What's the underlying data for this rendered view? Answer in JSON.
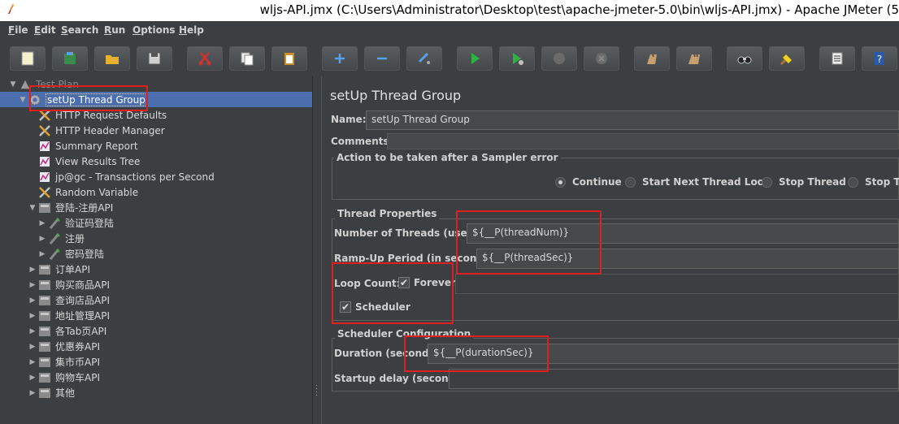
{
  "window": {
    "title": "wljs-API.jmx (C:\\Users\\Administrator\\Desktop\\test\\apache-jmeter-5.0\\bin\\wljs-API.jmx) - Apache JMeter (5"
  },
  "menu": [
    {
      "mn": "F",
      "rest": "ile"
    },
    {
      "mn": "E",
      "rest": "dit"
    },
    {
      "mn": "S",
      "rest": "earch"
    },
    {
      "mn": "R",
      "rest": "un"
    },
    {
      "mn": "O",
      "rest": "ptions"
    },
    {
      "mn": "H",
      "rest": "elp"
    }
  ],
  "toolbar": {
    "icons": [
      "new-icon",
      "templates-icon",
      "open-icon",
      "save-icon",
      "cut-icon",
      "copy-icon",
      "paste-icon",
      "expand-icon",
      "collapse-icon",
      "toggle-icon",
      "start-icon",
      "start-no-pause-icon",
      "stop-icon",
      "shutdown-icon",
      "clear-icon",
      "clear-all-icon",
      "search-icon",
      "reset-search-icon",
      "function-helper-icon",
      "help-icon"
    ]
  },
  "tree": [
    {
      "label": "Test Plan",
      "arrow": "▼",
      "icon": "test-plan-icon",
      "indent": 0
    },
    {
      "label": "setUp Thread Group",
      "arrow": "▼",
      "icon": "gear-icon",
      "indent": 1,
      "selected": true
    },
    {
      "label": "HTTP Request Defaults",
      "arrow": "",
      "icon": "config-tool-icon",
      "indent": 2
    },
    {
      "label": "HTTP Header Manager",
      "arrow": "",
      "icon": "config-tool-icon",
      "indent": 2
    },
    {
      "label": "Summary Report",
      "arrow": "",
      "icon": "listener-icon",
      "indent": 2
    },
    {
      "label": "View Results Tree",
      "arrow": "",
      "icon": "listener-icon",
      "indent": 2
    },
    {
      "label": "jp@gc - Transactions per Second",
      "arrow": "",
      "icon": "listener-icon",
      "indent": 2
    },
    {
      "label": "Random Variable",
      "arrow": "",
      "icon": "config-tool-icon",
      "indent": 2
    },
    {
      "label": "登陆-注册API",
      "arrow": "▼",
      "icon": "controller-icon",
      "indent": 2
    },
    {
      "label": "验证码登陆",
      "arrow": "▶",
      "icon": "sampler-icon",
      "indent": 3
    },
    {
      "label": "注册",
      "arrow": "▶",
      "icon": "sampler-icon",
      "indent": 3
    },
    {
      "label": "密码登陆",
      "arrow": "▶",
      "icon": "sampler-icon",
      "indent": 3
    },
    {
      "label": "订单API",
      "arrow": "▶",
      "icon": "controller-icon",
      "indent": 2
    },
    {
      "label": "购买商品API",
      "arrow": "▶",
      "icon": "controller-icon",
      "indent": 2
    },
    {
      "label": "查询店品API",
      "arrow": "▶",
      "icon": "controller-icon",
      "indent": 2
    },
    {
      "label": "地址管理API",
      "arrow": "▶",
      "icon": "controller-icon",
      "indent": 2
    },
    {
      "label": "各Tab页API",
      "arrow": "▶",
      "icon": "controller-icon",
      "indent": 2
    },
    {
      "label": "优惠券API",
      "arrow": "▶",
      "icon": "controller-icon",
      "indent": 2
    },
    {
      "label": "集市币API",
      "arrow": "▶",
      "icon": "controller-icon",
      "indent": 2
    },
    {
      "label": "购物车API",
      "arrow": "▶",
      "icon": "controller-icon",
      "indent": 2
    },
    {
      "label": "其他",
      "arrow": "▶",
      "icon": "controller-icon",
      "indent": 2
    }
  ],
  "panel": {
    "heading": "setUp Thread Group",
    "name_label": "Name:",
    "name_value": "setUp Thread Group",
    "comments_label": "Comments:",
    "comments_value": "",
    "error_group_title": "Action to be taken after a Sampler error",
    "error_options": [
      {
        "label": "Continue",
        "selected": true
      },
      {
        "label": "Start Next Thread Loop",
        "selected": false
      },
      {
        "label": "Stop Thread",
        "selected": false
      },
      {
        "label": "Stop Te",
        "selected": false
      }
    ],
    "thread_group_title": "Thread Properties",
    "threads_label": "Number of Threads (users):",
    "threads_value": "${__P(threadNum)}",
    "rampup_label": "Ramp-Up Period (in seconds):",
    "rampup_value": "${__P(threadSec)}",
    "loop_label": "Loop Count:",
    "forever_label": "Forever",
    "forever_checked": true,
    "loop_value": "",
    "scheduler_label": "Scheduler",
    "scheduler_checked": true,
    "scheduler_group_title": "Scheduler Configuration",
    "duration_label": "Duration (seconds)",
    "duration_value": "${__P(durationSec)}",
    "startup_label": "Startup delay (seconds)",
    "startup_value": ""
  }
}
